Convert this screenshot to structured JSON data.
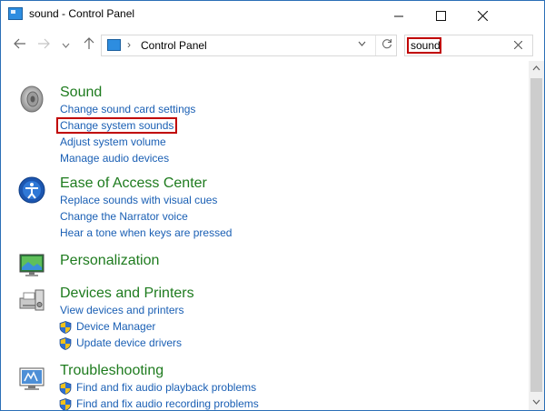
{
  "window": {
    "title": "sound - Control Panel",
    "minimize_icon": "minimize-icon",
    "maximize_icon": "maximize-icon",
    "close_icon": "close-icon"
  },
  "nav": {
    "back_icon": "back-arrow-icon",
    "forward_icon": "forward-arrow-icon",
    "recent_icon": "chevron-down-icon",
    "up_icon": "up-arrow-icon"
  },
  "address": {
    "separator": "›",
    "path": "Control Panel"
  },
  "search": {
    "value": "sound",
    "clear_icon": "close-icon"
  },
  "highlight_color": "#c00000",
  "groups": [
    {
      "title": "Sound",
      "icon": "speaker-icon",
      "links": [
        {
          "label": "Change sound card settings"
        },
        {
          "label": "Change system sounds",
          "highlighted": true
        },
        {
          "label": "Adjust system volume"
        },
        {
          "label": "Manage audio devices"
        }
      ]
    },
    {
      "title": "Ease of Access Center",
      "icon": "ease-of-access-icon",
      "links": [
        {
          "label": "Replace sounds with visual cues"
        },
        {
          "label": "Change the Narrator voice"
        },
        {
          "label": "Hear a tone when keys are pressed"
        }
      ]
    },
    {
      "title": "Personalization",
      "icon": "personalization-icon",
      "links": []
    },
    {
      "title": "Devices and Printers",
      "icon": "devices-printers-icon",
      "links": [
        {
          "label": "View devices and printers"
        },
        {
          "label": "Device Manager",
          "shield": true
        },
        {
          "label": "Update device drivers",
          "shield": true
        }
      ]
    },
    {
      "title": "Troubleshooting",
      "icon": "troubleshooting-icon",
      "links": [
        {
          "label": "Find and fix audio playback problems",
          "shield": true
        },
        {
          "label": "Find and fix audio recording problems",
          "shield": true
        }
      ]
    }
  ]
}
